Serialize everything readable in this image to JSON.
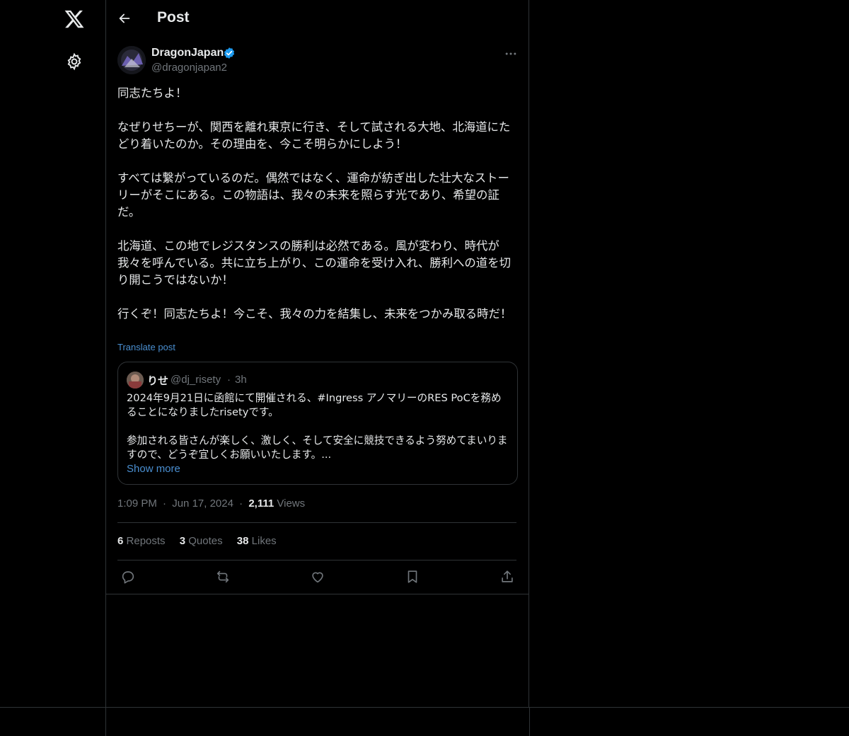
{
  "header": {
    "title": "Post"
  },
  "post": {
    "author_name": "DragonJapan",
    "author_handle": "@dragonjapan2",
    "text": "同志たちよ！\n\nなぜりせちーが、関西を離れ東京に行き、そして試される大地、北海道にたどり着いたのか。その理由を、今こそ明らかにしよう！\n\nすべては繋がっているのだ。偶然ではなく、運命が紡ぎ出した壮大なストーリーがそこにある。この物語は、我々の未来を照らす光であり、希望の証だ。\n\n北海道、この地でレジスタンスの勝利は必然である。風が変わり、時代が我々を呼んでいる。共に立ち上がり、この運命を受け入れ、勝利への道を切り開こうではないか！\n\n行くぞ！同志たちよ！今こそ、我々の力を結集し、未来をつかみ取る時だ！",
    "translate_label": "Translate post",
    "time": "1:09 PM",
    "date": "Jun 17, 2024",
    "views_count": "2,111",
    "views_label": "Views"
  },
  "quote": {
    "name": "りせ",
    "handle": "@dj_risety",
    "dot": "·",
    "time": "3h",
    "text": "2024年9月21日に函館にて開催される、#Ingress アノマリーのRES PoCを務めることになりましたrisetyです。\n\n参加される皆さんが楽しく、激しく、そして安全に競技できるよう努めてまいりますので、どうぞ宜しくお願いいたします。...",
    "show_more": "Show more"
  },
  "stats": {
    "reposts_count": "6",
    "reposts_label": "Reposts",
    "quotes_count": "3",
    "quotes_label": "Quotes",
    "likes_count": "38",
    "likes_label": "Likes"
  },
  "meta_sep": "·",
  "colors": {
    "background": "#000000",
    "text": "#e7e9ea",
    "muted": "#71767b",
    "link": "#4a8fd1",
    "verified": "#1d9bf0",
    "border": "#2f3336"
  },
  "icons": [
    "x-logo-icon",
    "gear-icon",
    "back-arrow-icon",
    "verified-badge-icon",
    "more-icon",
    "reply-icon",
    "repost-icon",
    "like-icon",
    "bookmark-icon",
    "share-icon"
  ]
}
